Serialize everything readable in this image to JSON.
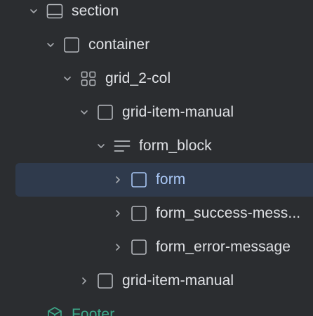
{
  "tree": {
    "items": [
      {
        "label": "section",
        "icon": "section-icon",
        "chevron": "expanded"
      },
      {
        "label": "container",
        "icon": "box-icon",
        "chevron": "expanded"
      },
      {
        "label": "grid_2-col",
        "icon": "grid-icon",
        "chevron": "expanded"
      },
      {
        "label": "grid-item-manual",
        "icon": "box-icon",
        "chevron": "expanded"
      },
      {
        "label": "form_block",
        "icon": "form-block-icon",
        "chevron": "expanded"
      },
      {
        "label": "form",
        "icon": "box-icon",
        "chevron": "collapsed",
        "selected": true
      },
      {
        "label": "form_success-mess...",
        "icon": "box-icon",
        "chevron": "collapsed"
      },
      {
        "label": "form_error-message",
        "icon": "box-icon",
        "chevron": "collapsed"
      },
      {
        "label": "grid-item-manual",
        "icon": "box-icon",
        "chevron": "collapsed"
      },
      {
        "label": "Footer",
        "icon": "component-icon",
        "chevron": "none"
      }
    ]
  },
  "colors": {
    "background": "#2b2d30",
    "text": "#dfe1e5",
    "selected_background": "#2f3a4c",
    "selected_text": "#a9c7f5",
    "component": "#3ea98a"
  }
}
